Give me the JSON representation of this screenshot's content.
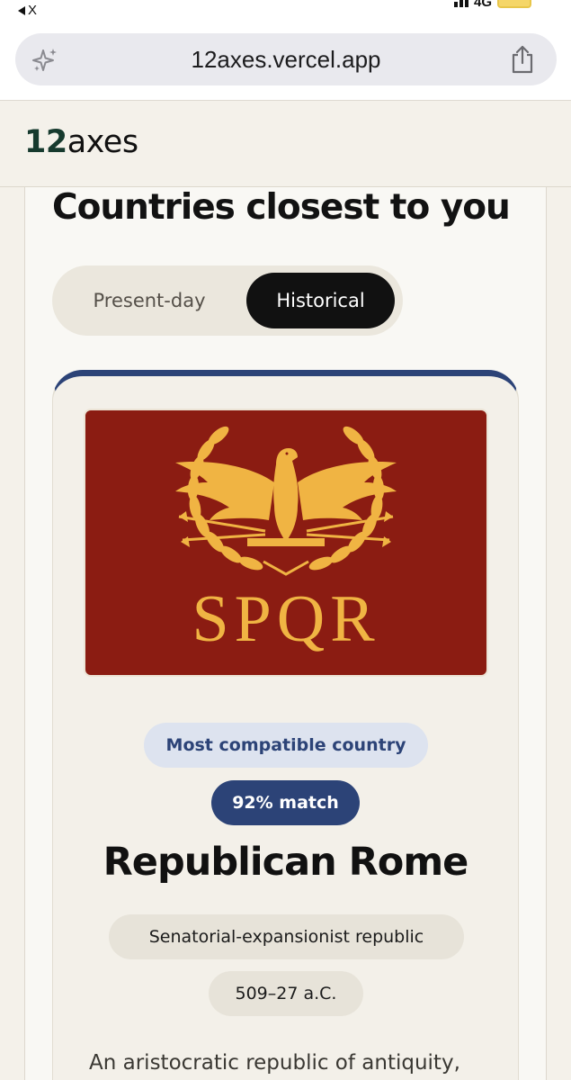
{
  "status_bar": {
    "back_app_label": "X"
  },
  "browser": {
    "url": "12axes.vercel.app",
    "icons": {
      "left": "sparkle-icon",
      "right": "share-icon"
    }
  },
  "site": {
    "logo_number": "12",
    "logo_word": "axes"
  },
  "page": {
    "title": "Countries closest to you",
    "toggle": {
      "options": [
        "Present-day",
        "Historical"
      ],
      "selected": "Historical"
    }
  },
  "result_card": {
    "accent_color": "#2c4377",
    "flag": {
      "emblem": "golden-eagle-laurel-emblem",
      "text": "SPQR",
      "background_color": "#8b1c12",
      "emblem_color": "#f0b443"
    },
    "badge": "Most compatible country",
    "match": "92% match",
    "country_name": "Republican Rome",
    "government_type": "Senatorial-expansionist republic",
    "dates": "509–27 a.C.",
    "description": "An aristocratic republic of antiquity,"
  }
}
